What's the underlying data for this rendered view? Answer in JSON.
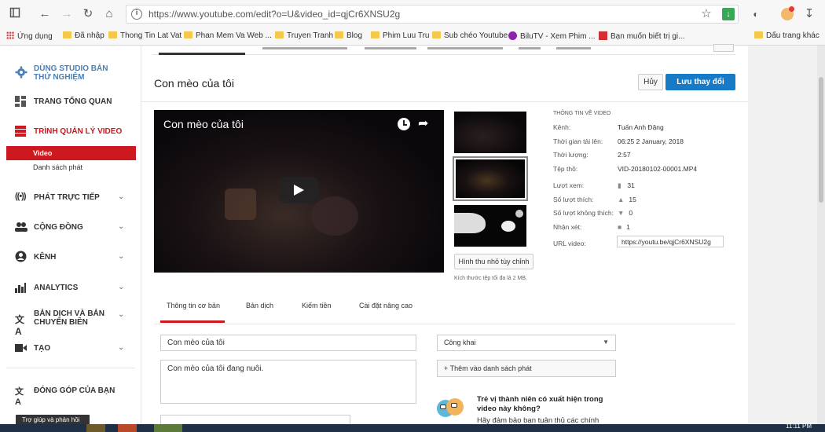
{
  "browser": {
    "url": "https://www.youtube.com/edit?o=U&video_id=qjCr6XNSU2g",
    "bookmarks": [
      {
        "label": "Ứng dụng"
      },
      {
        "label": "Đã nhập"
      },
      {
        "label": "Thong Tin Lat Vat"
      },
      {
        "label": "Phan Mem Va Web ..."
      },
      {
        "label": "Truyen Tranh"
      },
      {
        "label": "Blog"
      },
      {
        "label": "Phim Luu Tru"
      },
      {
        "label": "Sub chéo Youtube"
      },
      {
        "label": "BiluTV - Xem Phim ..."
      },
      {
        "label": "Bạn muốn biết trị gi..."
      },
      {
        "label": "Dấu trang khác"
      }
    ]
  },
  "sidebar": {
    "items": [
      {
        "label": "DÙNG STUDIO BẢN THỬ NGHIỆM",
        "icon": "gear-icon"
      },
      {
        "label": "TRANG TỔNG QUAN",
        "icon": "dashboard-icon"
      },
      {
        "label": "TRÌNH QUẢN LÝ VIDEO",
        "icon": "video-manager-icon"
      },
      {
        "label": "PHÁT TRỰC TIẾP",
        "icon": "live-icon"
      },
      {
        "label": "CỘNG ĐỒNG",
        "icon": "community-icon"
      },
      {
        "label": "KÊNH",
        "icon": "channel-icon"
      },
      {
        "label": "ANALYTICS",
        "icon": "analytics-icon"
      },
      {
        "label": "BẢN DỊCH VÀ BẢN CHUYỂN BIÊN",
        "icon": "translate-icon"
      },
      {
        "label": "TẠO",
        "icon": "create-icon"
      },
      {
        "label": "ĐÓNG GÓP CỦA BẠN",
        "icon": "contribute-icon"
      }
    ],
    "subitems": [
      {
        "label": "Video"
      },
      {
        "label": "Danh sách phát"
      }
    ],
    "help_button": "Trợ giúp và phản hồi"
  },
  "editor": {
    "title": "Con mèo của tôi",
    "cancel_label": "Hủy",
    "save_label": "Lưu thay đổi",
    "player_title": "Con mèo của tôi",
    "thumbnail_button": "Hình thu nhỏ tùy chỉnh",
    "thumbnail_note": "Kích thước tệp tối đa là 2 MB.",
    "info_heading": "THÔNG TIN VỀ VIDEO",
    "info": {
      "channel_label": "Kênh:",
      "channel": "Tuấn Anh Đặng",
      "uploaded_label": "Thời gian tải lên:",
      "uploaded": "06:25 2 January, 2018",
      "duration_label": "Thời lượng:",
      "duration": "2:57",
      "file_label": "Tệp thô:",
      "file": "VID-20180102-00001.MP4",
      "views_label": "Lượt xem:",
      "views": "31",
      "likes_label": "Số lượt thích:",
      "likes": "15",
      "dislikes_label": "Số lượt không thích:",
      "dislikes": "0",
      "comments_label": "Nhận xét:",
      "comments": "1",
      "url_label": "URL video:",
      "url": "https://youtu.be/qjCr6XNSU2g"
    },
    "tabs": [
      {
        "label": "Thông tin cơ bản"
      },
      {
        "label": "Bản dịch"
      },
      {
        "label": "Kiếm tiền"
      },
      {
        "label": "Cài đặt nâng cao"
      }
    ],
    "title_field": "Con mèo của tôi",
    "description_field": "Con mèo của tôi đang nuôi.",
    "privacy": "Công khai",
    "add_playlist": "+ Thêm vào danh sách phát",
    "kids_question": "Trẻ vị thành niên có xuất hiện trong video này không?",
    "kids_note": "Hãy đảm bảo bạn tuân thủ các chính"
  },
  "taskbar": {
    "clock": "11:11 PM"
  },
  "colors": {
    "accent": "#cc181e",
    "primary": "#167ac6"
  }
}
